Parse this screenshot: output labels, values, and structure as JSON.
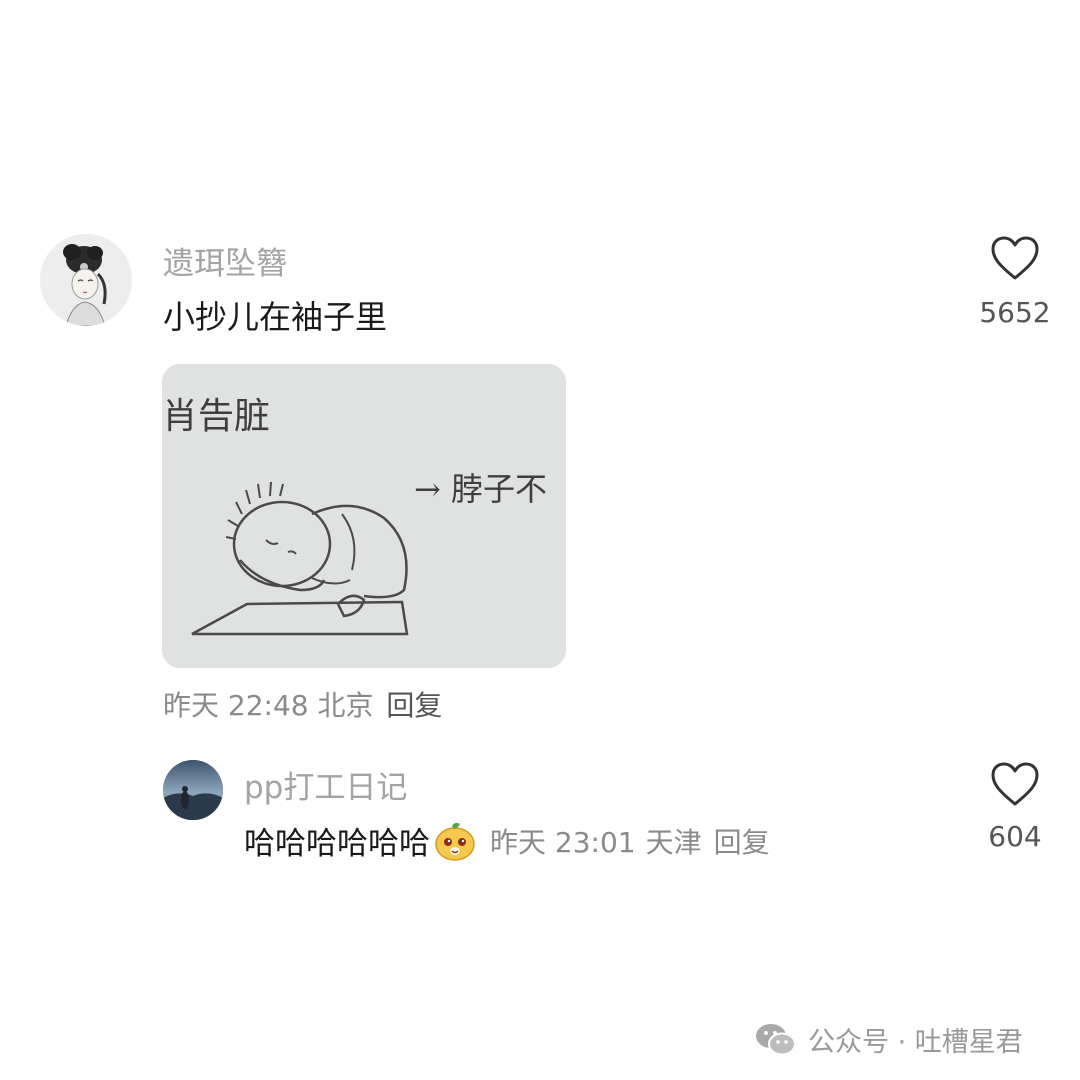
{
  "comment": {
    "username": "遗珥坠簪",
    "text": "小抄儿在袖子里",
    "likes": "5652",
    "time": "昨天 22:48",
    "location": "北京",
    "reply_label": "回复",
    "avatar_icon": "avatar-ancient-lady",
    "image_text_top": "肖告脏",
    "image_text_right": "→ 脖子不"
  },
  "reply": {
    "username": "pp打工日记",
    "text": "哈哈哈哈哈哈",
    "emoji_icon": "laughing-bear-emoji",
    "time": "昨天 23:01",
    "location": "天津",
    "reply_label": "回复",
    "likes": "604",
    "avatar_icon": "avatar-night-landscape"
  },
  "watermark": {
    "text": "公众号 · 吐槽星君",
    "icon": "wechat-icon"
  },
  "colors": {
    "username": "#a3a3a3",
    "meta": "#8a8a8a",
    "text": "#1a1a1a"
  }
}
